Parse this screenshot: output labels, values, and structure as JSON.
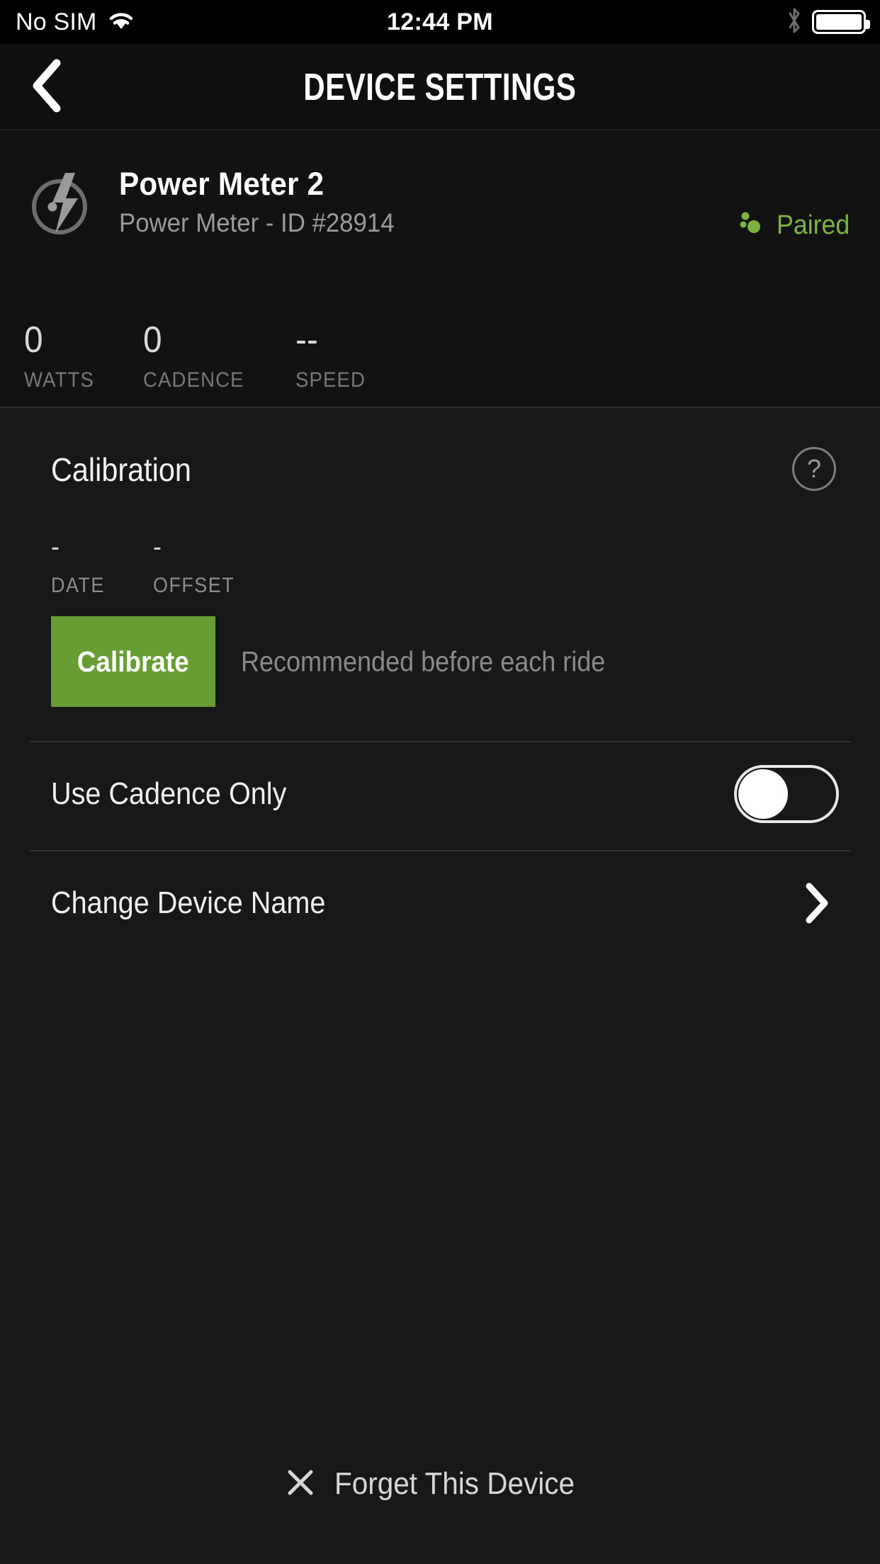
{
  "status_bar": {
    "carrier": "No SIM",
    "wifi_icon": "wifi-icon",
    "time": "12:44 PM",
    "bluetooth_icon": "bluetooth-icon",
    "battery_icon": "battery-full-icon"
  },
  "nav": {
    "back_icon": "chevron-left-icon",
    "title": "DEVICE SETTINGS"
  },
  "device": {
    "icon": "power-meter-gauge-icon",
    "name": "Power Meter 2",
    "subtitle": "Power Meter - ID #28914",
    "pair_status": "Paired",
    "pair_icon": "ant-plus-icon",
    "pair_color": "#7cb342",
    "metrics": [
      {
        "value": "0",
        "label": "WATTS"
      },
      {
        "value": "0",
        "label": "CADENCE"
      },
      {
        "value": "--",
        "label": "SPEED"
      }
    ]
  },
  "calibration": {
    "title": "Calibration",
    "help_icon": "question-mark-circle-icon",
    "fields": [
      {
        "value": "-",
        "label": "DATE"
      },
      {
        "value": "-",
        "label": "OFFSET"
      }
    ],
    "button_label": "Calibrate",
    "button_color": "#679d33",
    "hint": "Recommended before each ride"
  },
  "settings": {
    "cadence_only": {
      "label": "Use Cadence Only",
      "toggle_state": "off"
    },
    "change_name": {
      "label": "Change Device Name",
      "chevron_icon": "chevron-right-icon"
    }
  },
  "footer": {
    "forget_icon": "close-x-icon",
    "forget_label": "Forget This Device"
  }
}
